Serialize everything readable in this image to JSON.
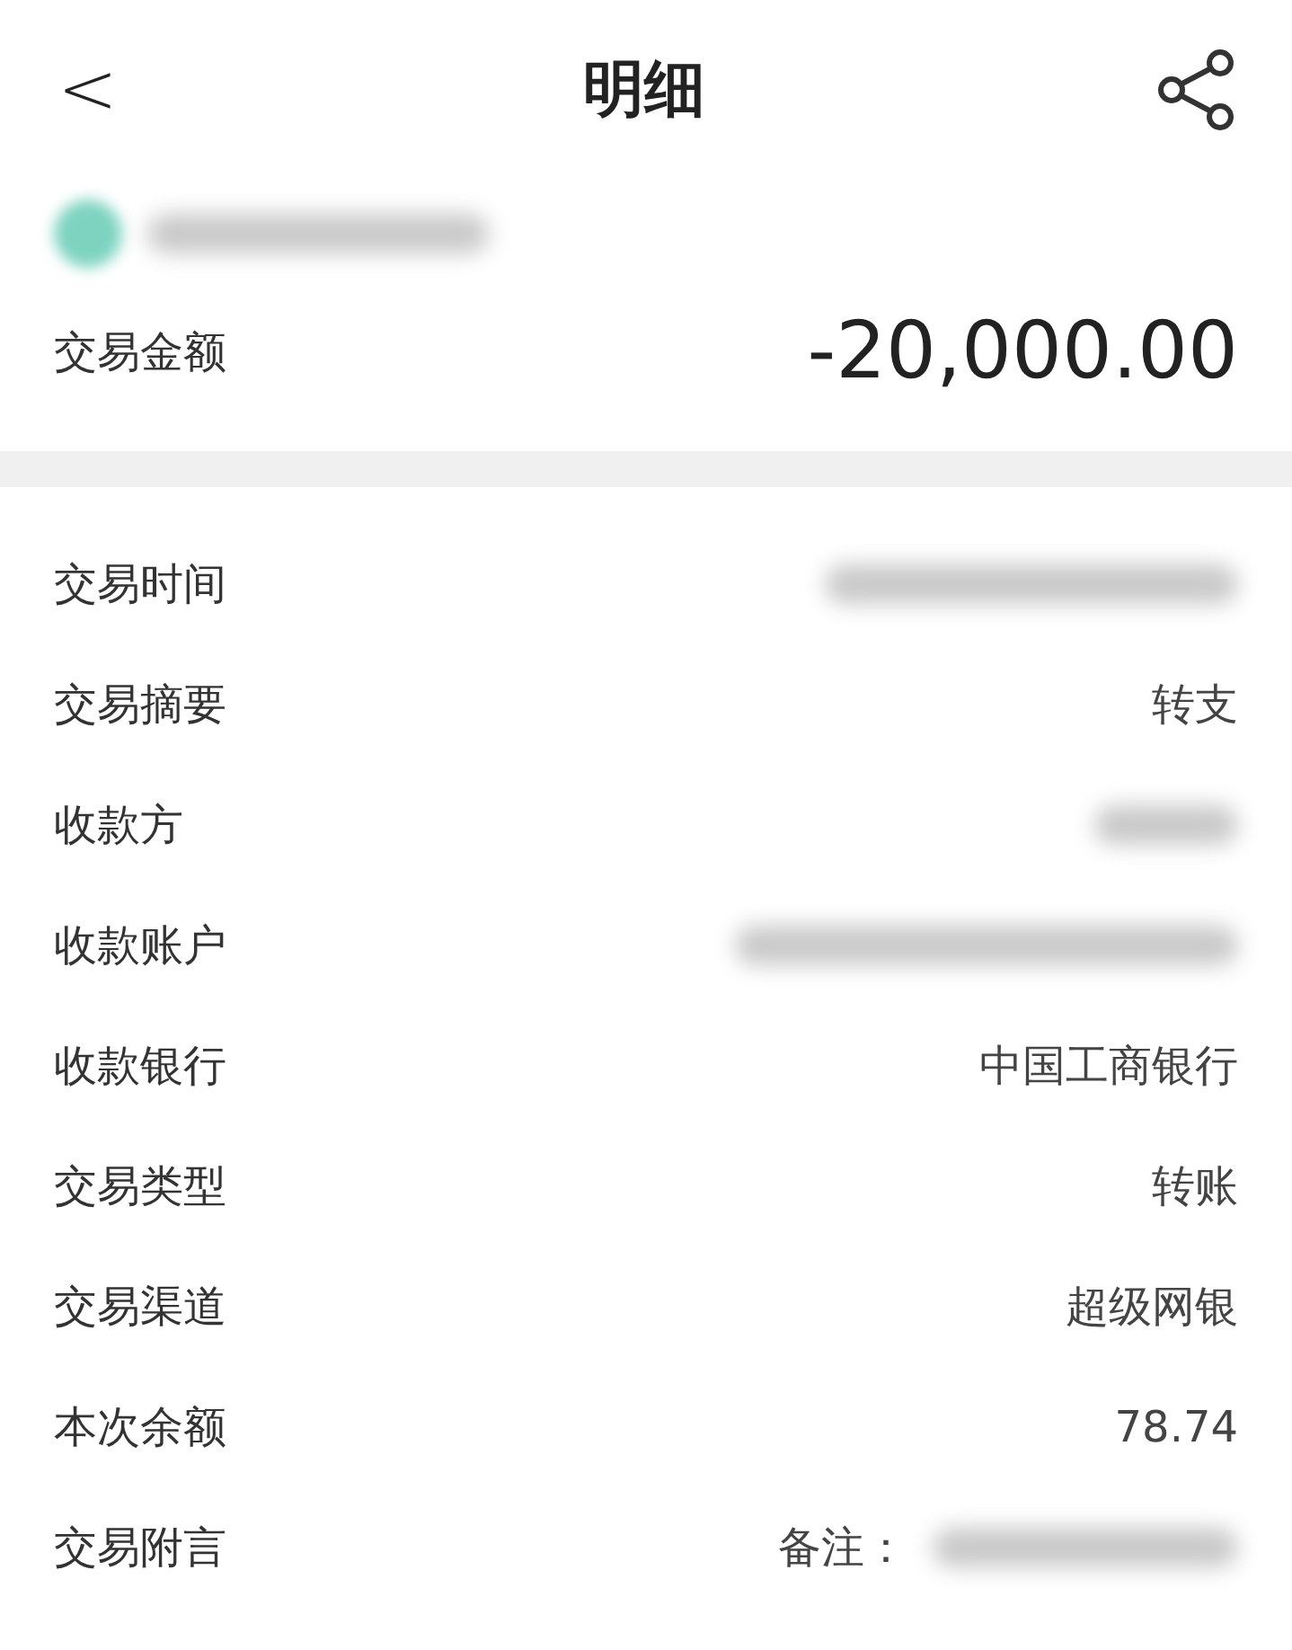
{
  "header": {
    "back": "<",
    "title": "明细"
  },
  "account": {
    "kind": "redacted"
  },
  "amount": {
    "label": "交易金额",
    "value": "-20,000.00"
  },
  "rows": [
    {
      "label": "交易时间",
      "kind": "redacted"
    },
    {
      "label": "交易摘要",
      "kind": "text",
      "value": "转支"
    },
    {
      "label": "收款方",
      "kind": "redacted"
    },
    {
      "label": "收款账户",
      "kind": "redacted"
    },
    {
      "label": "收款银行",
      "kind": "text",
      "value": "中国工商银行"
    },
    {
      "label": "交易类型",
      "kind": "text",
      "value": "转账"
    },
    {
      "label": "交易渠道",
      "kind": "text",
      "value": "超级网银"
    },
    {
      "label": "本次余额",
      "kind": "text",
      "value": "78.74"
    },
    {
      "label": "交易附言",
      "kind": "note",
      "value": "备注："
    }
  ]
}
